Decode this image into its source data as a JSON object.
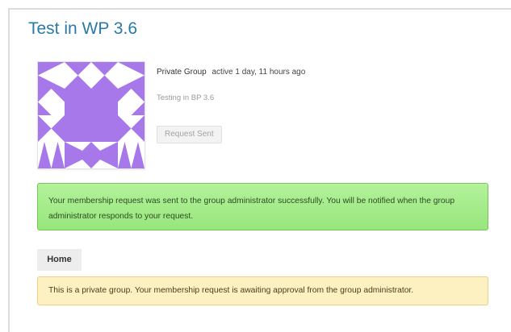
{
  "group": {
    "title": "Test in WP 3.6",
    "type_label": "Private Group",
    "activity": "active 1 day, 11 hours ago",
    "description": "Testing in BP 3.6",
    "request_button": "Request Sent",
    "avatar_color": "#a678ea"
  },
  "messages": {
    "success": "Your membership request was sent to the group administrator successfully. You will be notified when the group administrator responds to your request.",
    "notice": "This is a private group. Your membership request is awaiting approval from the group administrator."
  },
  "nav": {
    "home_label": "Home"
  }
}
